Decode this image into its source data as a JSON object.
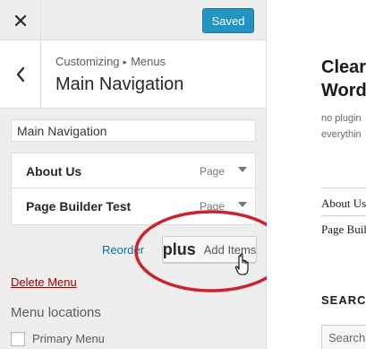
{
  "topbar": {
    "close_icon": "close-icon",
    "save_label": "Saved"
  },
  "section": {
    "breadcrumb_parent": "Customizing",
    "breadcrumb_arrow": "▸",
    "breadcrumb_child": "Menus",
    "title": "Main Navigation",
    "back_icon": "chevron-left-icon"
  },
  "menu": {
    "name_value": "Main Navigation",
    "items": [
      {
        "title": "About Us",
        "type": "Page"
      },
      {
        "title": "Page Builder Test",
        "type": "Page"
      }
    ],
    "reorder_label": "Reorder",
    "add_items_label": "Add Items",
    "add_items_icon": "plus",
    "delete_label": "Delete Menu",
    "locations_title": "Menu locations",
    "locations": [
      {
        "label": "Primary Menu",
        "checked": false
      }
    ]
  },
  "annotation": {
    "color": "#d0202b",
    "shape": "ellipse"
  },
  "preview": {
    "site_title_line1": "Clear",
    "site_title_line2": "Word",
    "desc_line1": "no plugin",
    "desc_line2": "everythin",
    "links": [
      "About Us",
      "Page Buil"
    ],
    "search_heading": "SEARCH",
    "search_placeholder": "Search"
  },
  "colors": {
    "primary": "#0085ba",
    "link": "#0073aa",
    "delete": "#a00000",
    "sidebar_bg": "#eeeeee"
  }
}
